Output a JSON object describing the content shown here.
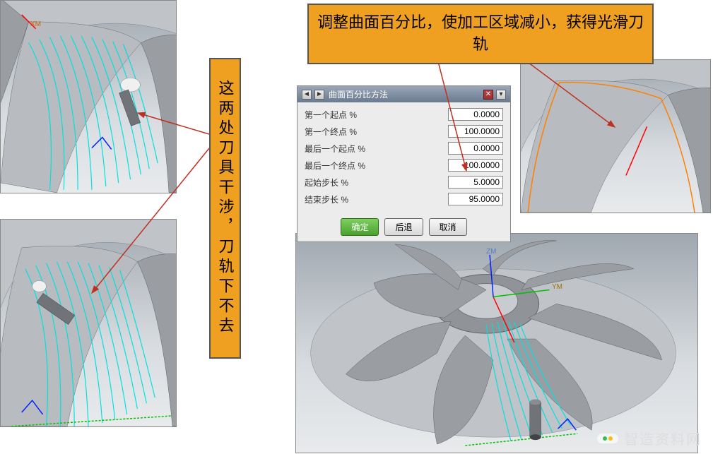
{
  "callouts": {
    "top": "调整曲面百分比，使加工区域减小，获得光滑刀轨",
    "left": "这两处刀具干涉，刀轨下不去"
  },
  "dialog": {
    "title": "曲面百分比方法",
    "nav_prev": "◄",
    "nav_next": "►",
    "close": "✕",
    "menu": "▾",
    "fields": [
      {
        "label": "第一个起点 %",
        "value": "0.0000"
      },
      {
        "label": "第一个终点 %",
        "value": "100.0000"
      },
      {
        "label": "最后一个起点 %",
        "value": "0.0000"
      },
      {
        "label": "最后一个终点 %",
        "value": "100.0000"
      },
      {
        "label": "起始步长 %",
        "value": "5.0000"
      },
      {
        "label": "结束步长 %",
        "value": "95.0000"
      }
    ],
    "buttons": {
      "ok": "确定",
      "back": "后退",
      "cancel": "取消"
    }
  },
  "axes": {
    "xm": "XM",
    "ym": "YM"
  },
  "brand": "智造资料网"
}
